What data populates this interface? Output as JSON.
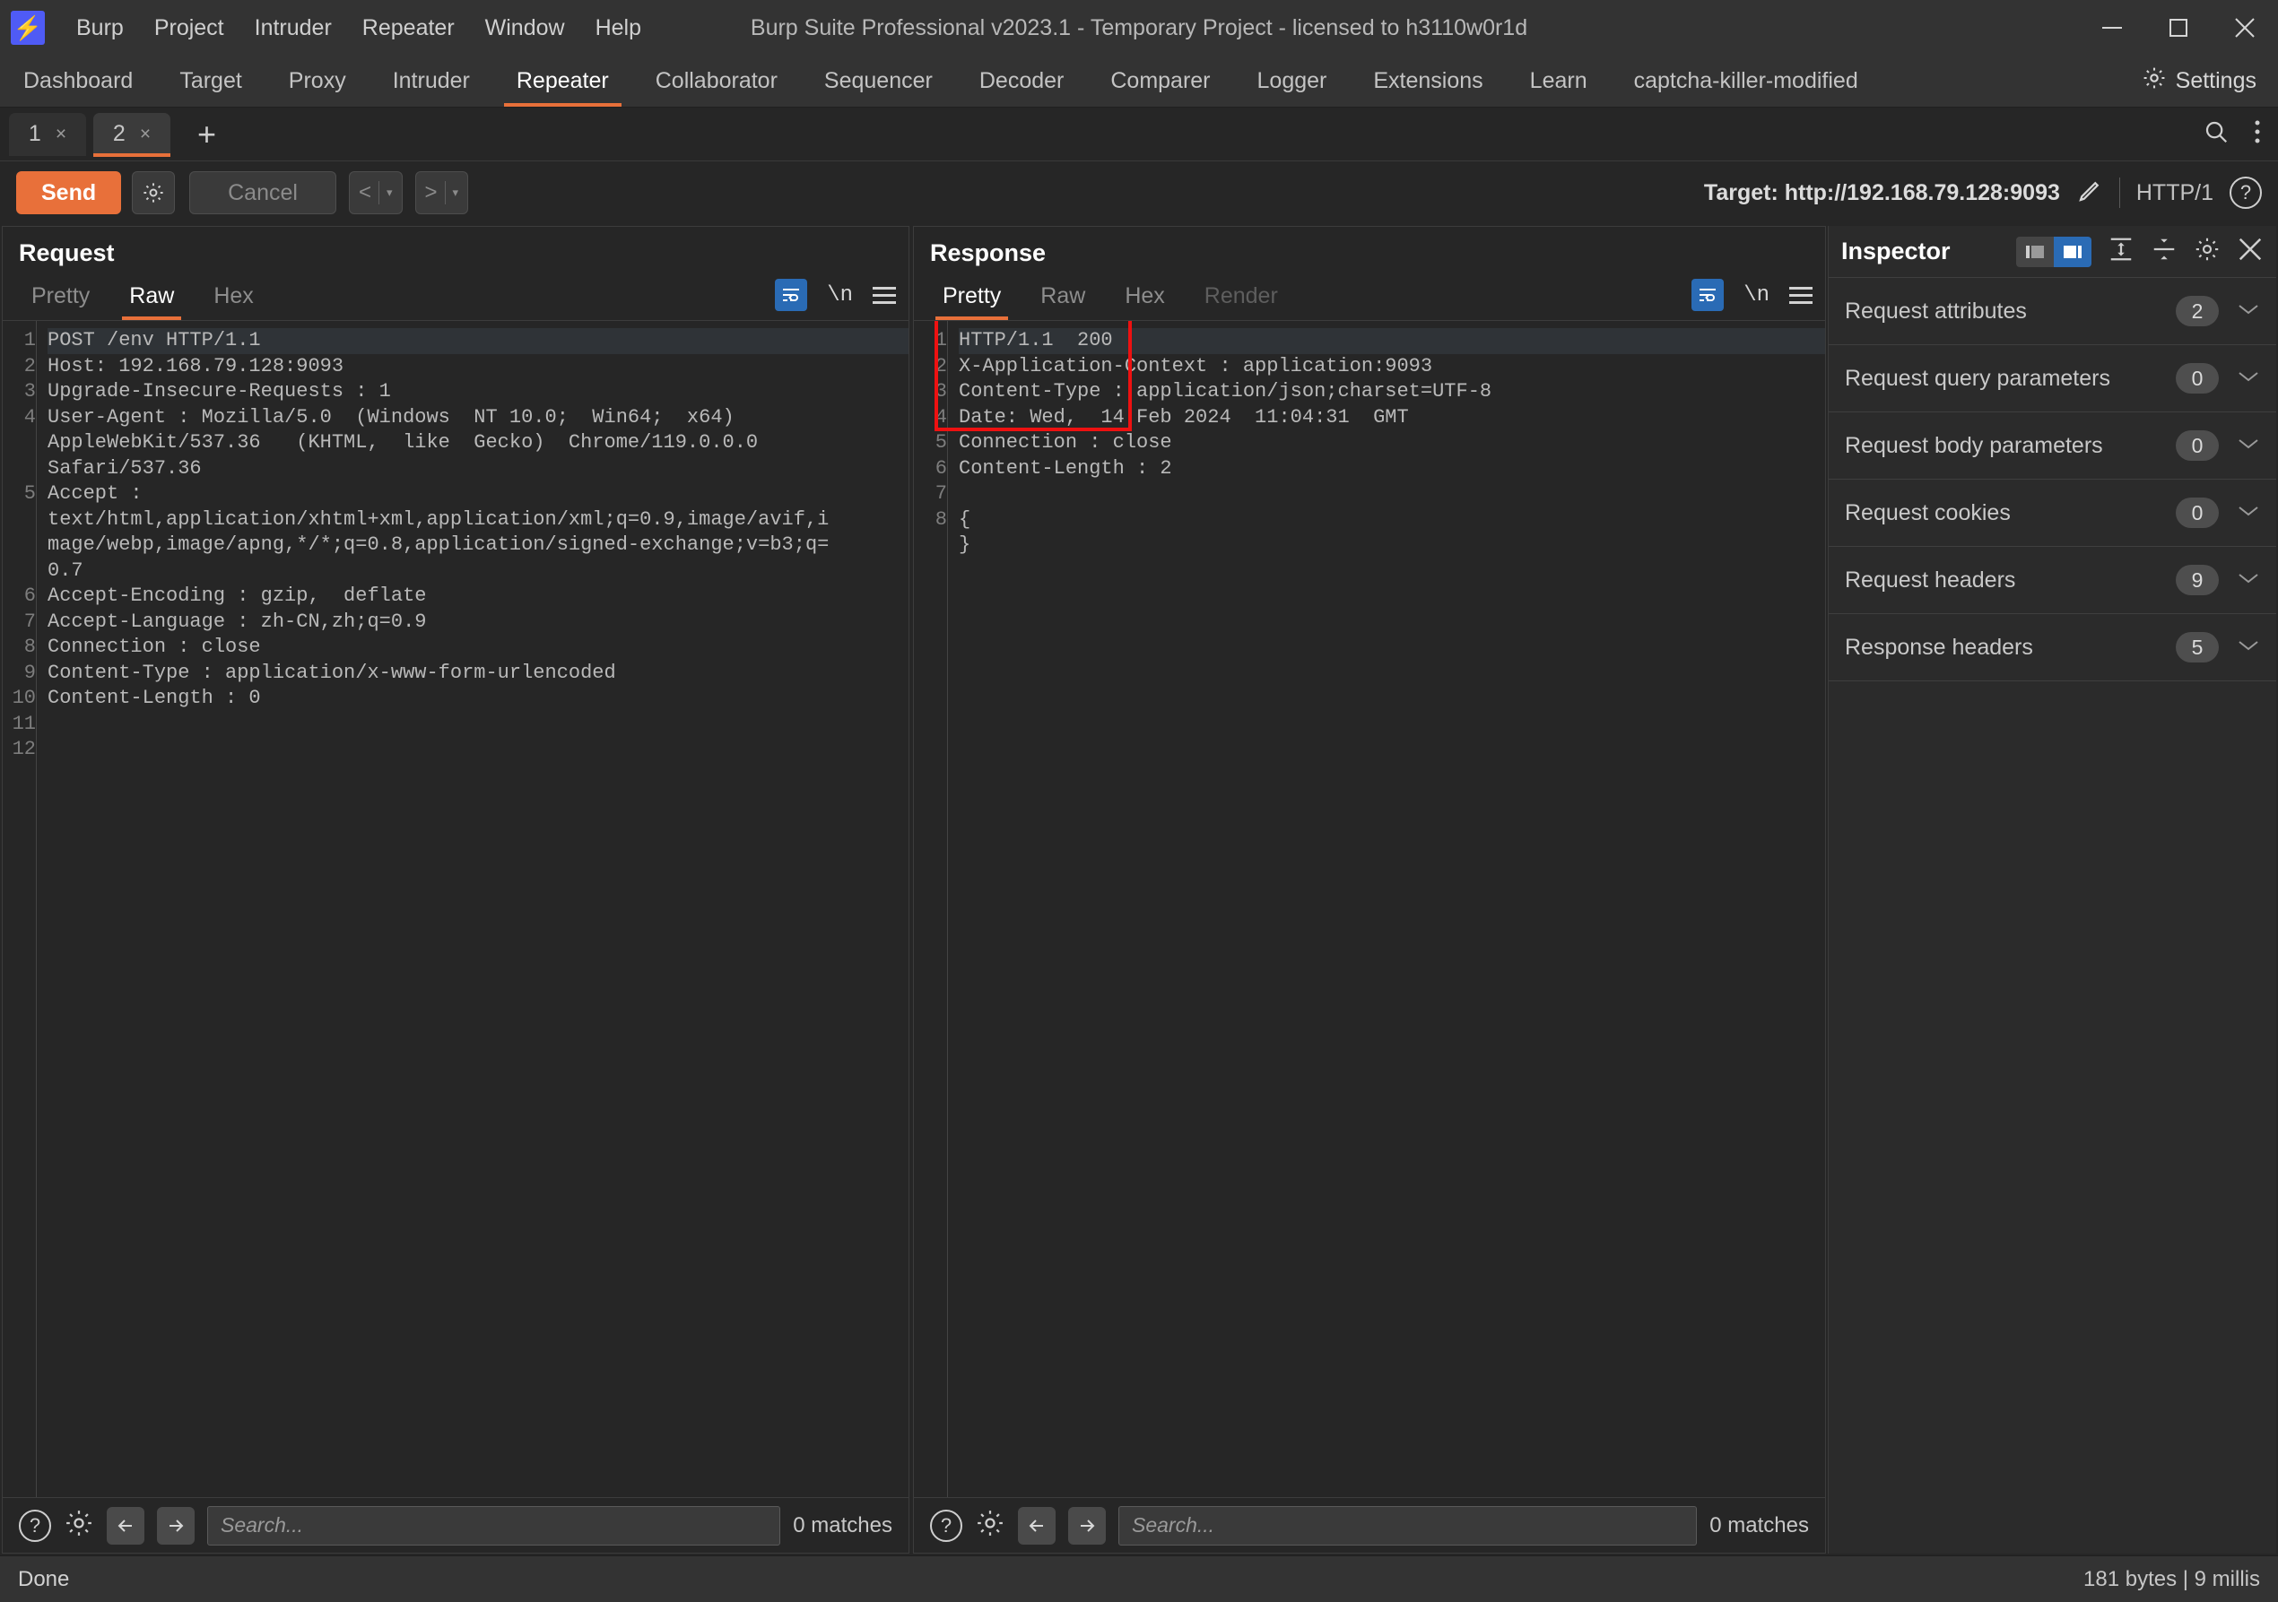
{
  "window": {
    "title": "Burp Suite Professional v2023.1 - Temporary Project - licensed to h3110w0r1d",
    "minimize": "–",
    "maximize": "☐",
    "close": "✕"
  },
  "menu": {
    "items": [
      "Burp",
      "Project",
      "Intruder",
      "Repeater",
      "Window",
      "Help"
    ]
  },
  "tabbar": {
    "items": [
      "Dashboard",
      "Target",
      "Proxy",
      "Intruder",
      "Repeater",
      "Collaborator",
      "Sequencer",
      "Decoder",
      "Comparer",
      "Logger",
      "Extensions",
      "Learn",
      "captcha-killer-modified"
    ],
    "active": "Repeater",
    "settings_label": "Settings",
    "settings_icon": "gear-icon"
  },
  "repeater_tabs": {
    "items": [
      {
        "label": "1",
        "close": "×",
        "active": false
      },
      {
        "label": "2",
        "close": "×",
        "active": true
      }
    ],
    "add_label": "+",
    "search_icon": "search-icon",
    "menu_icon": "vertical-dots-icon"
  },
  "toolbar": {
    "send_label": "Send",
    "settings_icon": "gear-icon",
    "cancel_label": "Cancel",
    "prev_label": "<",
    "next_label": ">",
    "caret": "▾",
    "target_label": "Target: http://192.168.79.128:9093",
    "edit_icon": "pencil-icon",
    "http_version": "HTTP/1",
    "help_icon": "question-mark-icon"
  },
  "request_panel": {
    "title": "Request",
    "format_tabs": [
      {
        "label": "Pretty",
        "active": false,
        "disabled": false
      },
      {
        "label": "Raw",
        "active": true,
        "disabled": false
      },
      {
        "label": "Hex",
        "active": false,
        "disabled": false
      }
    ],
    "wrap_icon": "word-wrap-icon",
    "newline_icon": "\\n",
    "menu_icon": "hamburger-menu-icon",
    "line_numbers": [
      "1",
      "2",
      "3",
      "4",
      "",
      "",
      "5",
      "",
      "",
      "",
      "6",
      "7",
      "8",
      "9",
      "10",
      "11",
      "12"
    ],
    "lines": [
      "POST /env HTTP/1.1",
      "Host: 192.168.79.128:9093",
      "Upgrade-Insecure-Requests : 1",
      "User-Agent : Mozilla/5.0  (Windows  NT 10.0;  Win64;  x64)",
      "AppleWebKit/537.36   (KHTML,  like  Gecko)  Chrome/119.0.0.0",
      "Safari/537.36",
      "Accept :",
      "text/html,application/xhtml+xml,application/xml;q=0.9,image/avif,i",
      "mage/webp,image/apng,*/*;q=0.8,application/signed-exchange;v=b3;q=",
      "0.7",
      "Accept-Encoding : gzip,  deflate",
      "Accept-Language : zh-CN,zh;q=0.9",
      "Connection : close",
      "Content-Type : application/x-www-form-urlencoded",
      "Content-Length : 0",
      "",
      ""
    ],
    "footer": {
      "help_icon": "question-mark-icon",
      "settings_icon": "gear-icon",
      "prev_icon": "arrow-left-icon",
      "next_icon": "arrow-right-icon",
      "search_placeholder": "Search...",
      "search_value": "",
      "matches": "0 matches"
    }
  },
  "response_panel": {
    "title": "Response",
    "layout_buttons": [
      {
        "name": "side-by-side-layout",
        "active": true
      },
      {
        "name": "stacked-layout",
        "active": false
      },
      {
        "name": "single-layout",
        "active": false
      }
    ],
    "format_tabs": [
      {
        "label": "Pretty",
        "active": true,
        "disabled": false
      },
      {
        "label": "Raw",
        "active": false,
        "disabled": false
      },
      {
        "label": "Hex",
        "active": false,
        "disabled": false
      },
      {
        "label": "Render",
        "active": false,
        "disabled": true
      }
    ],
    "wrap_icon": "word-wrap-icon",
    "newline_icon": "\\n",
    "menu_icon": "hamburger-menu-icon",
    "line_numbers": [
      "1",
      "2",
      "3",
      "4",
      "5",
      "6",
      "7",
      "8",
      ""
    ],
    "lines": [
      "HTTP/1.1  200",
      "X-Application-Context : application:9093",
      "Content-Type : application/json;charset=UTF-8",
      "Date: Wed,  14 Feb 2024  11:04:31  GMT",
      "Connection : close",
      "Content-Length : 2",
      "",
      "{",
      "}"
    ],
    "footer": {
      "help_icon": "question-mark-icon",
      "settings_icon": "gear-icon",
      "prev_icon": "arrow-left-icon",
      "next_icon": "arrow-right-icon",
      "search_placeholder": "Search...",
      "search_value": "",
      "matches": "0 matches"
    }
  },
  "annotation": {
    "color": "#ee1111",
    "name": "red-highlight-box"
  },
  "inspector": {
    "title": "Inspector",
    "dock_buttons": [
      {
        "name": "dock-left",
        "active": false
      },
      {
        "name": "dock-right",
        "active": true
      }
    ],
    "expand_icon": "expand-all-icon",
    "collapse_icon": "collapse-all-icon",
    "settings_icon": "gear-icon",
    "close_icon": "close-icon",
    "rows": [
      {
        "label": "Request attributes",
        "count": "2"
      },
      {
        "label": "Request query parameters",
        "count": "0"
      },
      {
        "label": "Request body parameters",
        "count": "0"
      },
      {
        "label": "Request cookies",
        "count": "0"
      },
      {
        "label": "Request headers",
        "count": "9"
      },
      {
        "label": "Response headers",
        "count": "5"
      }
    ],
    "chevron": "∨"
  },
  "statusbar": {
    "left": "Done",
    "right": "181 bytes | 9 millis"
  },
  "colors": {
    "accent_orange": "#e8703a",
    "accent_blue": "#2a6bb5",
    "annotation_red": "#ee1111",
    "bg": "#262626",
    "chrome": "#333333"
  }
}
